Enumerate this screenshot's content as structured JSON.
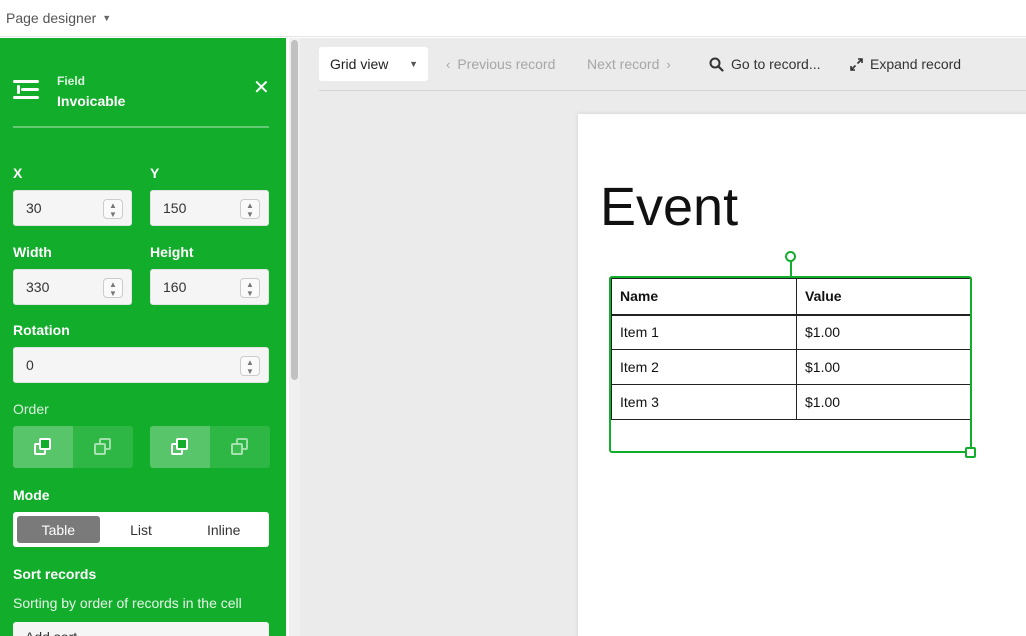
{
  "app": {
    "title": "Page designer"
  },
  "sidebar": {
    "kicker": "Field",
    "title": "Invoicable",
    "x_label": "X",
    "x_value": "30",
    "y_label": "Y",
    "y_value": "150",
    "width_label": "Width",
    "width_value": "330",
    "height_label": "Height",
    "height_value": "160",
    "rotation_label": "Rotation",
    "rotation_value": "0",
    "order_label": "Order",
    "mode_label": "Mode",
    "modes": [
      "Table",
      "List",
      "Inline"
    ],
    "selected_mode": "Table",
    "sort_label": "Sort records",
    "sort_desc": "Sorting by order of records in the cell",
    "add_sort": "Add sort"
  },
  "toolbar": {
    "view": "Grid view",
    "prev": "Previous record",
    "next": "Next record",
    "goto": "Go to record...",
    "expand": "Expand record"
  },
  "page": {
    "title": "Event",
    "table": {
      "headers": [
        "Name",
        "Value"
      ],
      "rows": [
        [
          "Item 1",
          "$1.00"
        ],
        [
          "Item 2",
          "$1.00"
        ],
        [
          "Item 3",
          "$1.00"
        ]
      ]
    }
  },
  "colors": {
    "accent": "#12ad2b",
    "canvas": "#ebebeb"
  },
  "icons": [
    "field-settings-icon",
    "close-icon",
    "chevron-left-icon",
    "chevron-right-icon",
    "search-icon",
    "expand-icon",
    "bring-forward-icon",
    "send-backward-icon",
    "bring-to-front-icon",
    "send-to-back-icon"
  ]
}
